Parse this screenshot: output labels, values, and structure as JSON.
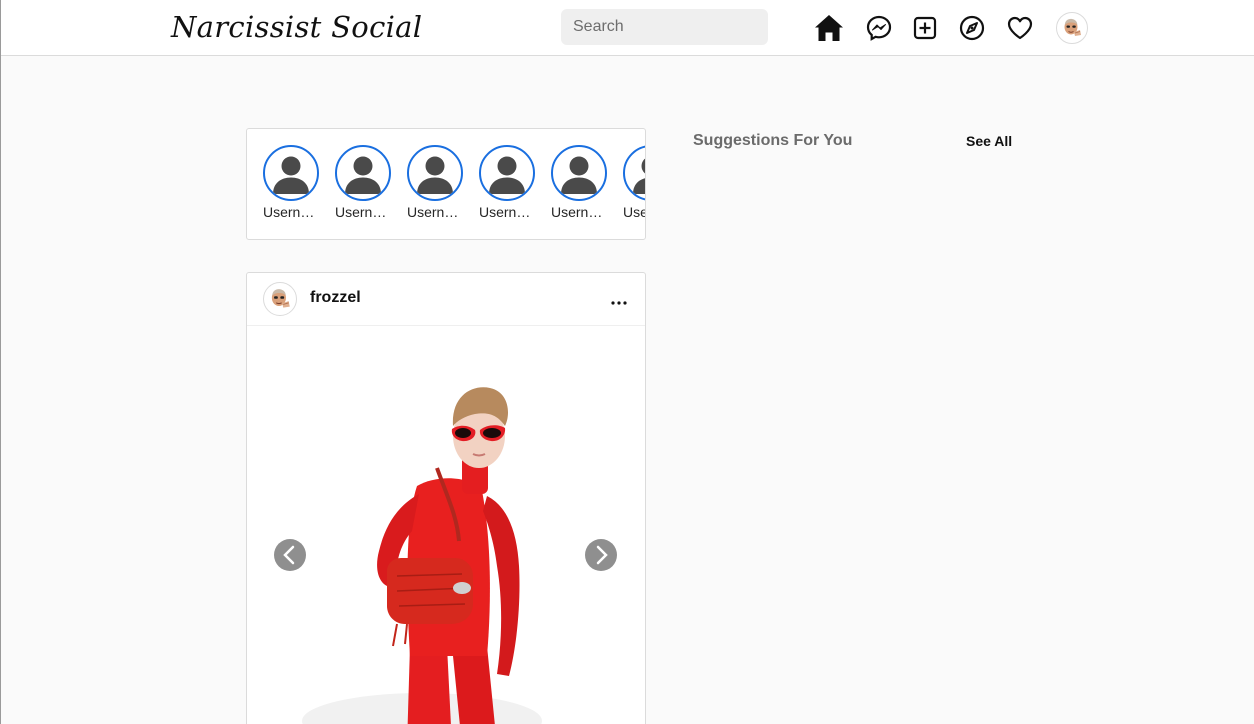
{
  "app": {
    "logo": "Narcissist Social"
  },
  "search": {
    "placeholder": "Search"
  },
  "nav": {
    "icons": [
      "home-icon",
      "messenger-icon",
      "new-post-icon",
      "explore-icon",
      "activity-heart-icon",
      "profile-avatar"
    ]
  },
  "stories": {
    "items": [
      {
        "label": "Username"
      },
      {
        "label": "Username"
      },
      {
        "label": "Username"
      },
      {
        "label": "Username"
      },
      {
        "label": "Username"
      },
      {
        "label": "Username"
      }
    ]
  },
  "post": {
    "username": "frozzel",
    "more_label": "...",
    "image": "model-in-red-bodysuit-with-red-handbag-and-red-sunglasses"
  },
  "suggestions": {
    "title": "Suggestions For You",
    "see_all": "See All"
  },
  "colors": {
    "story_ring": "#1a6fe0",
    "background": "#fafafa",
    "border": "#dbdbdb"
  }
}
